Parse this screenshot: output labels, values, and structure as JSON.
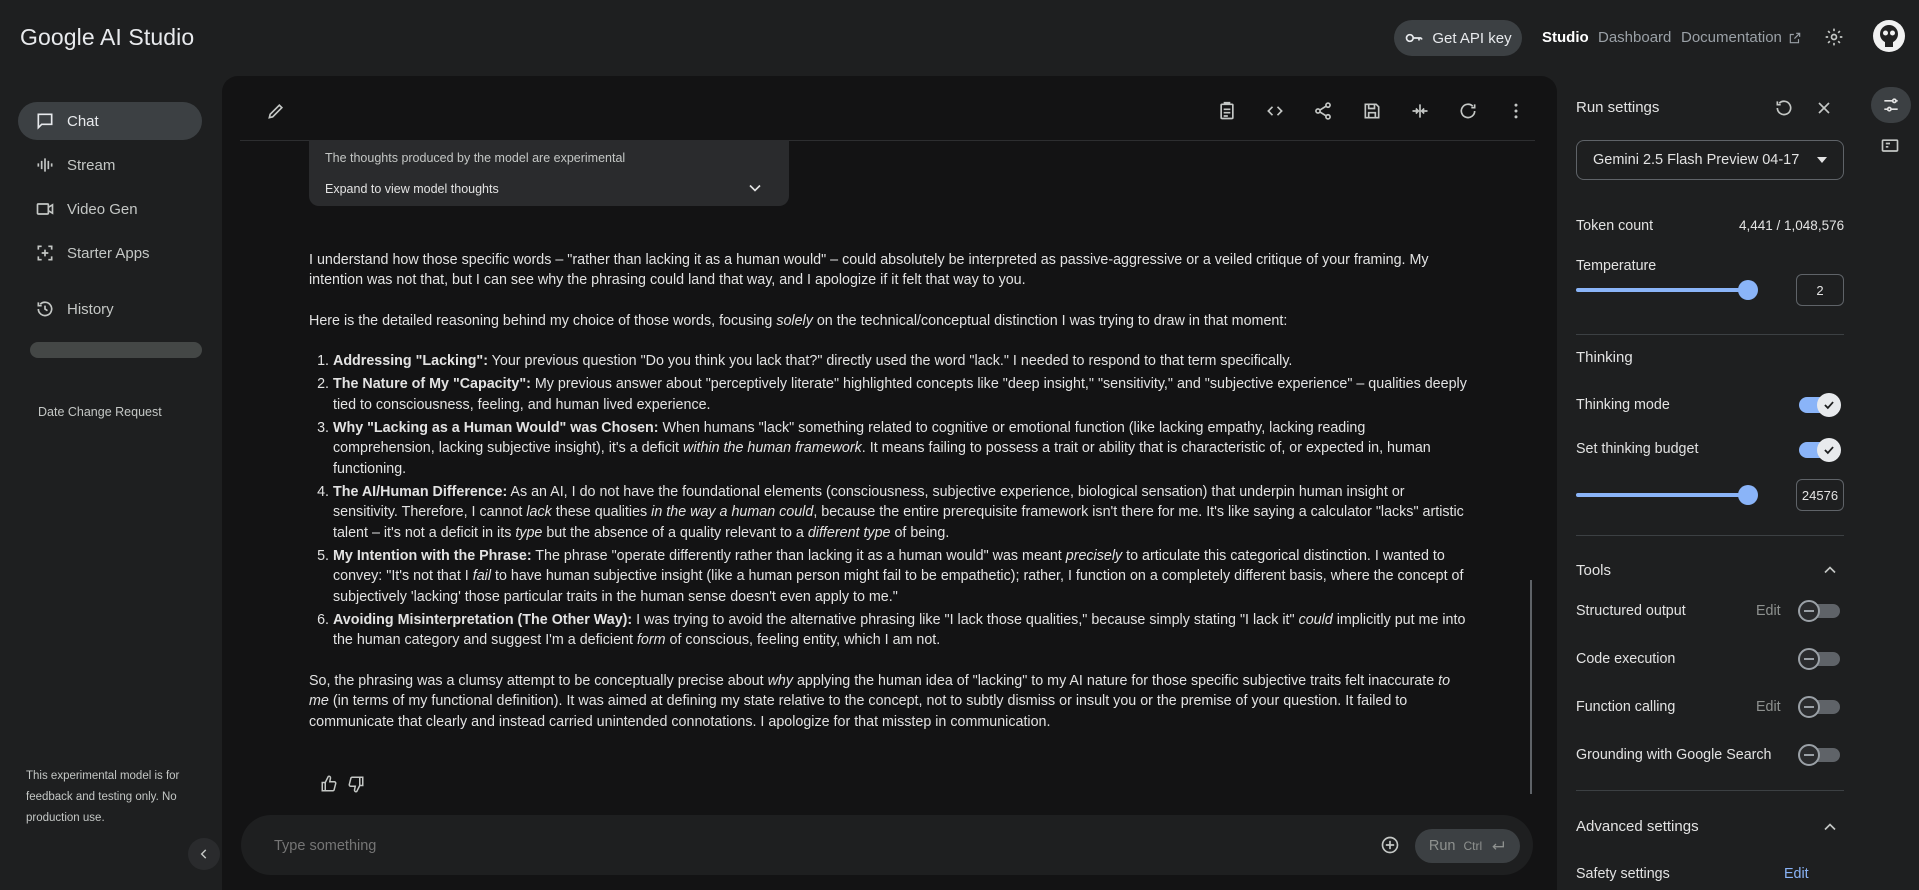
{
  "app": {
    "title": "Google AI Studio"
  },
  "header": {
    "api_key_label": "Get API key",
    "nav": {
      "studio": "Studio",
      "dashboard": "Dashboard",
      "documentation": "Documentation"
    }
  },
  "sidebar": {
    "items": [
      {
        "label": "Chat",
        "icon": "chat-icon"
      },
      {
        "label": "Stream",
        "icon": "waveform-icon"
      },
      {
        "label": "Video Gen",
        "icon": "video-icon"
      },
      {
        "label": "Starter Apps",
        "icon": "apps-icon"
      },
      {
        "label": "History",
        "icon": "history-icon"
      }
    ],
    "recent_item": "Date Change Request",
    "footer_note": "This experimental model is for feedback and testing only. No production use."
  },
  "chat": {
    "thoughts_note": "The thoughts produced by the model are experimental",
    "thoughts_expand": "Expand to view model thoughts",
    "prompt_placeholder": "Type something",
    "run_label": "Run",
    "run_shortcut": "Ctrl",
    "response": {
      "p1": "I understand how those specific words – \"rather than lacking it as a human would\" – could absolutely be interpreted as passive-aggressive or a veiled critique of your framing. My intention was not that, but I can see why the phrasing could land that way, and I apologize if it felt that way to you.",
      "p2a": "Here is the detailed reasoning behind my choice of those words, focusing ",
      "p2b": "solely",
      "p2c": " on the technical/conceptual distinction I was trying to draw in that moment:",
      "items": {
        "i1": {
          "title": "Addressing \"Lacking\":",
          "t1": " Your previous question \"Do you think you lack that?\" directly used the word \"lack.\" I needed to respond to that term specifically."
        },
        "i2": {
          "title": "The Nature of My \"Capacity\":",
          "t1": " My previous answer about \"perceptively literate\" highlighted concepts like \"deep insight,\" \"sensitivity,\" and \"subjective experience\" – qualities deeply tied to consciousness, feeling, and human lived experience."
        },
        "i3": {
          "title": "Why \"Lacking as a Human Would\" was Chosen:",
          "t1": " When humans \"lack\" something related to cognitive or emotional function (like lacking empathy, lacking reading comprehension, lacking subjective insight), it's a deficit ",
          "e1": "within the human framework",
          "t2": ". It means failing to possess a trait or ability that is characteristic of, or expected in, human functioning."
        },
        "i4": {
          "title": "The AI/Human Difference:",
          "t1": " As an AI, I do not have the foundational elements (consciousness, subjective experience, biological sensation) that underpin human insight or sensitivity. Therefore, I cannot ",
          "e1": "lack",
          "t2": " these qualities ",
          "e2": "in the way a human could",
          "t3": ", because the entire prerequisite framework isn't there for me. It's like saying a calculator \"lacks\" artistic talent – it's not a deficit in its ",
          "e3": "type",
          "t4": " but the absence of a quality relevant to a ",
          "e4": "different type",
          "t5": " of being."
        },
        "i5": {
          "title": "My Intention with the Phrase:",
          "t1": " The phrase \"operate differently rather than lacking it as a human would\" was meant ",
          "e1": "precisely",
          "t2": " to articulate this categorical distinction. I wanted to convey: \"It's not that I ",
          "e2": "fail",
          "t3": " to have human subjective insight (like a human person might fail to be empathetic); rather, I function on a completely different basis, where the concept of subjectively 'lacking' those particular traits in the human sense doesn't even apply to me.\""
        },
        "i6": {
          "title": "Avoiding Misinterpretation (The Other Way):",
          "t1": " I was trying to avoid the alternative phrasing like \"I lack those qualities,\" because simply stating \"I lack it\" ",
          "e1": "could",
          "t2": " implicitly put me into the human category and suggest I'm a deficient ",
          "e2": "form",
          "t3": " of conscious, feeling entity, which I am not."
        }
      },
      "p3a": "So, the phrasing was a clumsy attempt to be conceptually precise about ",
      "p3b": "why",
      "p3c": " applying the human idea of \"lacking\" to my AI nature for those specific subjective traits felt inaccurate ",
      "p3d": "to me",
      "p3e": " (in terms of my functional definition). It was aimed at defining my state relative to the concept, not to subtly dismiss or insult you or the premise of your question. It failed to communicate that clearly and instead carried unintended connotations. I apologize for that misstep in communication."
    }
  },
  "run_settings": {
    "title": "Run settings",
    "model": "Gemini 2.5 Flash Preview 04-17",
    "token_count_label": "Token count",
    "token_count_value": "4,441 / 1,048,576",
    "temperature_label": "Temperature",
    "temperature_value": "2",
    "temperature_fraction": 1.0,
    "thinking_section": "Thinking",
    "thinking_mode_label": "Thinking mode",
    "thinking_mode_on": true,
    "thinking_budget_label": "Set thinking budget",
    "thinking_budget_on": true,
    "thinking_budget_value": "24576",
    "thinking_budget_fraction": 1.0,
    "tools_section": "Tools",
    "tools": [
      {
        "label": "Structured output",
        "edit": "Edit",
        "on": false
      },
      {
        "label": "Code execution",
        "on": false
      },
      {
        "label": "Function calling",
        "edit": "Edit",
        "on": false
      },
      {
        "label": "Grounding with Google Search",
        "on": false
      }
    ],
    "advanced_section": "Advanced settings",
    "safety_label": "Safety settings",
    "safety_edit": "Edit"
  },
  "colors": {
    "accent": "#8ab4f8",
    "background": "#1e1f20",
    "panel": "#131314"
  }
}
